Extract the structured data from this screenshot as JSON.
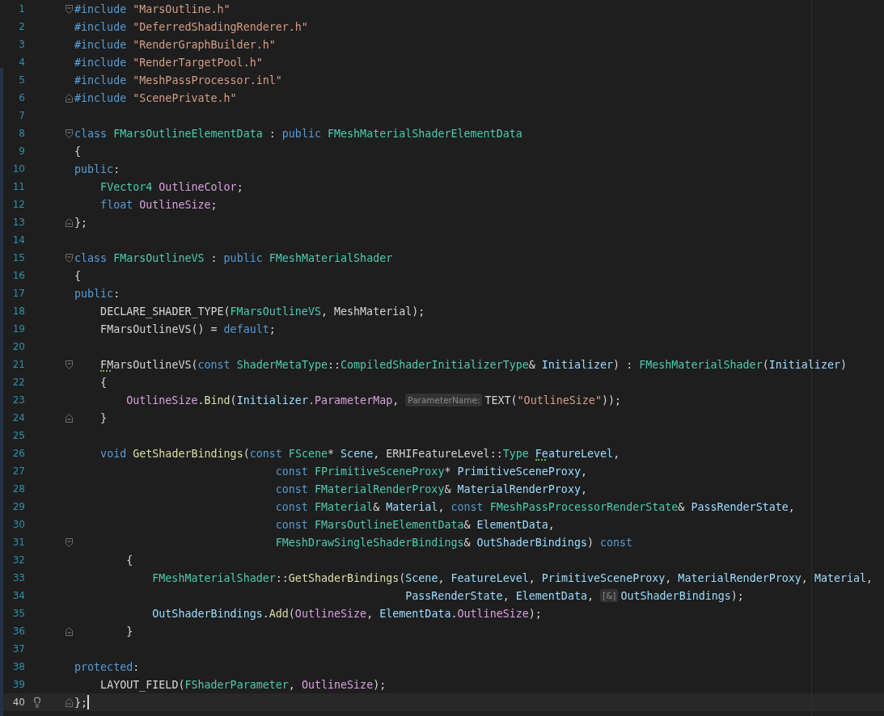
{
  "editor": {
    "lines": [
      {
        "number": "1",
        "fold_start": true,
        "tokens": [
          {
            "text": "#include",
            "kind": "keyword"
          },
          {
            "text": " \"MarsOutline.h\"",
            "kind": "string"
          }
        ]
      },
      {
        "number": "2",
        "tokens": [
          {
            "text": "#include",
            "kind": "keyword"
          },
          {
            "text": " \"DeferredShadingRenderer.h\"",
            "kind": "string"
          }
        ]
      },
      {
        "number": "3",
        "tokens": [
          {
            "text": "#include",
            "kind": "keyword"
          },
          {
            "text": " \"RenderGraphBuilder.h\"",
            "kind": "string"
          }
        ]
      },
      {
        "number": "4",
        "tokens": [
          {
            "text": "#include",
            "kind": "keyword"
          },
          {
            "text": " \"RenderTargetPool.h\"",
            "kind": "string"
          }
        ]
      },
      {
        "number": "5",
        "tokens": [
          {
            "text": "#include",
            "kind": "keyword"
          },
          {
            "text": " \"MeshPassProcessor.inl\"",
            "kind": "string"
          }
        ]
      },
      {
        "number": "6",
        "fold_end": true,
        "tokens": [
          {
            "text": "#include",
            "kind": "keyword"
          },
          {
            "text": " \"ScenePrivate.h\"",
            "kind": "string"
          }
        ]
      },
      {
        "number": "7"
      },
      {
        "number": "8",
        "fold_start": true,
        "tokens": [
          {
            "text": "class",
            "kind": "keyword"
          },
          {
            "text": " FMarsOutlineElementData",
            "kind": "type"
          },
          {
            "text": " :",
            "kind": "plain"
          },
          {
            "text": " public",
            "kind": "keyword"
          },
          {
            "text": " FMeshMaterialShaderElementData",
            "kind": "type"
          }
        ]
      },
      {
        "number": "9",
        "tokens": [
          {
            "text": "{",
            "kind": "plain"
          }
        ]
      },
      {
        "number": "10",
        "tokens": [
          {
            "text": "public",
            "kind": "keyword"
          },
          {
            "text": ":",
            "kind": "plain"
          }
        ]
      },
      {
        "number": "11",
        "tokens": [
          {
            "text": "    FVector4",
            "kind": "type"
          },
          {
            "text": " OutlineColor",
            "kind": "field"
          },
          {
            "text": ";",
            "kind": "plain"
          }
        ]
      },
      {
        "number": "12",
        "tokens": [
          {
            "text": "    float",
            "kind": "keyword"
          },
          {
            "text": " OutlineSize",
            "kind": "field"
          },
          {
            "text": ";",
            "kind": "plain"
          }
        ]
      },
      {
        "number": "13",
        "fold_end": true,
        "tokens": [
          {
            "text": "};",
            "kind": "plain"
          }
        ]
      },
      {
        "number": "14"
      },
      {
        "number": "15",
        "fold_start": true,
        "tokens": [
          {
            "text": "class",
            "kind": "keyword"
          },
          {
            "text": " FMarsOutlineVS",
            "kind": "type"
          },
          {
            "text": " :",
            "kind": "plain"
          },
          {
            "text": " public",
            "kind": "keyword"
          },
          {
            "text": " FMeshMaterialShader",
            "kind": "type"
          }
        ]
      },
      {
        "number": "16",
        "tokens": [
          {
            "text": "{",
            "kind": "plain"
          }
        ]
      },
      {
        "number": "17",
        "tokens": [
          {
            "text": "public",
            "kind": "keyword"
          },
          {
            "text": ":",
            "kind": "plain"
          }
        ]
      },
      {
        "number": "18",
        "tokens": [
          {
            "text": "    DECLARE_SHADER_TYPE(",
            "kind": "plain"
          },
          {
            "text": "FMarsOutlineVS",
            "kind": "type"
          },
          {
            "text": ", MeshMaterial);",
            "kind": "plain"
          }
        ]
      },
      {
        "number": "19",
        "tokens": [
          {
            "text": "    FMarsOutlineVS() =",
            "kind": "plain"
          },
          {
            "text": " default",
            "kind": "keyword"
          },
          {
            "text": ";",
            "kind": "plain"
          }
        ]
      },
      {
        "number": "20"
      },
      {
        "number": "21",
        "fold_start": true,
        "tokens": [
          {
            "text": "    FMarsOutlineVS",
            "kind": "plain",
            "warning": true
          },
          {
            "text": "(",
            "kind": "plain"
          },
          {
            "text": "const",
            "kind": "keyword"
          },
          {
            "text": " ShaderMetaType",
            "kind": "type"
          },
          {
            "text": "::",
            "kind": "plain"
          },
          {
            "text": "CompiledShaderInitializerType",
            "kind": "type"
          },
          {
            "text": "&",
            "kind": "plain"
          },
          {
            "text": " Initializer",
            "kind": "param"
          },
          {
            "text": ") :",
            "kind": "plain"
          },
          {
            "text": " FMeshMaterialShader",
            "kind": "type"
          },
          {
            "text": "(",
            "kind": "plain"
          },
          {
            "text": "Initializer",
            "kind": "param"
          },
          {
            "text": ")",
            "kind": "plain"
          }
        ]
      },
      {
        "number": "22",
        "tokens": [
          {
            "text": "    {",
            "kind": "plain"
          }
        ]
      },
      {
        "number": "23",
        "tokens": [
          {
            "text": "        OutlineSize",
            "kind": "field"
          },
          {
            "text": ".Bind",
            "kind": "function"
          },
          {
            "text": "(",
            "kind": "plain"
          },
          {
            "text": "Initializer",
            "kind": "param"
          },
          {
            "text": ".ParameterMap",
            "kind": "field"
          },
          {
            "text": ",",
            "kind": "plain"
          },
          {
            "text": " ParameterName:",
            "kind": "hint"
          },
          {
            "text": "TEXT(",
            "kind": "plain"
          },
          {
            "text": "\"OutlineSize\"",
            "kind": "string"
          },
          {
            "text": "));",
            "kind": "plain"
          }
        ]
      },
      {
        "number": "24",
        "fold_end": true,
        "tokens": [
          {
            "text": "    }",
            "kind": "plain"
          }
        ]
      },
      {
        "number": "25"
      },
      {
        "number": "26",
        "tokens": [
          {
            "text": "    void",
            "kind": "keyword"
          },
          {
            "text": " GetShaderBindings",
            "kind": "function"
          },
          {
            "text": "(",
            "kind": "plain"
          },
          {
            "text": "const",
            "kind": "keyword"
          },
          {
            "text": " FScene",
            "kind": "type"
          },
          {
            "text": "*",
            "kind": "plain"
          },
          {
            "text": " Scene",
            "kind": "param"
          },
          {
            "text": ", ERHIFeatureLevel::",
            "kind": "plain"
          },
          {
            "text": "Type",
            "kind": "type"
          },
          {
            "text": " FeatureLevel",
            "kind": "param",
            "warning": true
          },
          {
            "text": ",",
            "kind": "plain"
          }
        ]
      },
      {
        "number": "27",
        "tokens": [
          {
            "text": "                               const",
            "kind": "keyword"
          },
          {
            "text": " FPrimitiveSceneProxy",
            "kind": "type"
          },
          {
            "text": "*",
            "kind": "plain"
          },
          {
            "text": " PrimitiveSceneProxy",
            "kind": "param"
          },
          {
            "text": ",",
            "kind": "plain"
          }
        ]
      },
      {
        "number": "28",
        "tokens": [
          {
            "text": "                               const",
            "kind": "keyword"
          },
          {
            "text": " FMaterialRenderProxy",
            "kind": "type"
          },
          {
            "text": "&",
            "kind": "plain"
          },
          {
            "text": " MaterialRenderProxy",
            "kind": "param"
          },
          {
            "text": ",",
            "kind": "plain"
          }
        ]
      },
      {
        "number": "29",
        "tokens": [
          {
            "text": "                               const",
            "kind": "keyword"
          },
          {
            "text": " FMaterial",
            "kind": "type"
          },
          {
            "text": "&",
            "kind": "plain"
          },
          {
            "text": " Material",
            "kind": "param"
          },
          {
            "text": ",",
            "kind": "plain"
          },
          {
            "text": " const",
            "kind": "keyword"
          },
          {
            "text": " FMeshPassProcessorRenderState",
            "kind": "type"
          },
          {
            "text": "&",
            "kind": "plain"
          },
          {
            "text": " PassRenderState",
            "kind": "param"
          },
          {
            "text": ",",
            "kind": "plain"
          }
        ]
      },
      {
        "number": "30",
        "tokens": [
          {
            "text": "                               const",
            "kind": "keyword"
          },
          {
            "text": " FMarsOutlineElementData",
            "kind": "type"
          },
          {
            "text": "&",
            "kind": "plain"
          },
          {
            "text": " ElementData",
            "kind": "param"
          },
          {
            "text": ",",
            "kind": "plain"
          }
        ]
      },
      {
        "number": "31",
        "fold_start": true,
        "tokens": [
          {
            "text": "                               FMeshDrawSingleShaderBindings",
            "kind": "type"
          },
          {
            "text": "&",
            "kind": "plain"
          },
          {
            "text": " OutShaderBindings",
            "kind": "param"
          },
          {
            "text": ")",
            "kind": "plain"
          },
          {
            "text": " const",
            "kind": "keyword"
          }
        ]
      },
      {
        "number": "32",
        "tokens": [
          {
            "text": "        {",
            "kind": "plain"
          }
        ]
      },
      {
        "number": "33",
        "tokens": [
          {
            "text": "            FMeshMaterialShader",
            "kind": "type"
          },
          {
            "text": "::",
            "kind": "plain"
          },
          {
            "text": "GetShaderBindings",
            "kind": "function"
          },
          {
            "text": "(",
            "kind": "plain"
          },
          {
            "text": "Scene",
            "kind": "param"
          },
          {
            "text": ",",
            "kind": "plain"
          },
          {
            "text": " FeatureLevel",
            "kind": "param"
          },
          {
            "text": ",",
            "kind": "plain"
          },
          {
            "text": " PrimitiveSceneProxy",
            "kind": "param"
          },
          {
            "text": ",",
            "kind": "plain"
          },
          {
            "text": " MaterialRenderProxy",
            "kind": "param"
          },
          {
            "text": ",",
            "kind": "plain"
          },
          {
            "text": " Material",
            "kind": "param"
          },
          {
            "text": ",",
            "kind": "plain"
          }
        ]
      },
      {
        "number": "34",
        "tokens": [
          {
            "text": "                                                   PassRenderState",
            "kind": "param"
          },
          {
            "text": ",",
            "kind": "plain"
          },
          {
            "text": " ElementData",
            "kind": "param"
          },
          {
            "text": ",",
            "kind": "plain"
          },
          {
            "text": " [&]",
            "kind": "hint"
          },
          {
            "text": "OutShaderBindings",
            "kind": "param"
          },
          {
            "text": ");",
            "kind": "plain"
          }
        ]
      },
      {
        "number": "35",
        "tokens": [
          {
            "text": "            OutShaderBindings",
            "kind": "param"
          },
          {
            "text": ".",
            "kind": "plain"
          },
          {
            "text": "Add",
            "kind": "function"
          },
          {
            "text": "(",
            "kind": "plain"
          },
          {
            "text": "OutlineSize",
            "kind": "field"
          },
          {
            "text": ",",
            "kind": "plain"
          },
          {
            "text": " ElementData",
            "kind": "param"
          },
          {
            "text": ".",
            "kind": "plain"
          },
          {
            "text": "OutlineSize",
            "kind": "field"
          },
          {
            "text": ");",
            "kind": "plain"
          }
        ]
      },
      {
        "number": "36",
        "fold_end": true,
        "tokens": [
          {
            "text": "        }",
            "kind": "plain"
          }
        ]
      },
      {
        "number": "37"
      },
      {
        "number": "38",
        "tokens": [
          {
            "text": "protected",
            "kind": "keyword"
          },
          {
            "text": ":",
            "kind": "plain"
          }
        ]
      },
      {
        "number": "39",
        "tokens": [
          {
            "text": "    LAYOUT_FIELD(",
            "kind": "plain"
          },
          {
            "text": "FShaderParameter",
            "kind": "type"
          },
          {
            "text": ",",
            "kind": "plain"
          },
          {
            "text": " OutlineSize",
            "kind": "field"
          },
          {
            "text": ");",
            "kind": "plain"
          }
        ]
      },
      {
        "number": "40",
        "fold_end": true,
        "current": true,
        "bulb": true,
        "tokens": [
          {
            "text": "};",
            "kind": "plain"
          }
        ]
      }
    ]
  }
}
